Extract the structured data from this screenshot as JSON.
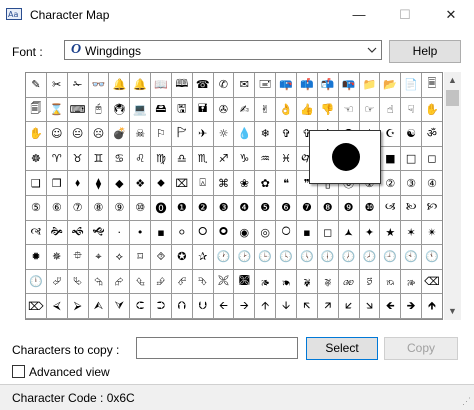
{
  "window": {
    "title": "Character Map",
    "min_glyph": "—",
    "max_glyph": "☐",
    "close_glyph": "✕"
  },
  "font": {
    "label": "Font :",
    "selected": "Wingdings"
  },
  "help_button": "Help",
  "grid": {
    "rows": [
      [
        "✎",
        "✂",
        "✁",
        "👓",
        "🔔",
        "🔔",
        "📖",
        "🕮",
        "☎",
        "✆",
        "✉",
        "🖃",
        "📪",
        "📫",
        "📬",
        "📭",
        "📁",
        "📂",
        "📄",
        "🗏"
      ],
      [
        "🗐",
        "⌛",
        "⌨",
        "🖰",
        "🖲",
        "💻",
        "🖴",
        "🖫",
        "🖬",
        "✇",
        "✍",
        "✌",
        "👌",
        "👍",
        "👎",
        "☜",
        "☞",
        "☝",
        "☟",
        "✋"
      ],
      [
        "✋",
        "☺",
        "😐",
        "☹",
        "💣",
        "☠",
        "⚐",
        "🏱",
        "✈",
        "☼",
        "💧",
        "❄",
        "✞",
        "✞",
        "✝",
        "✠",
        "✡",
        "☪",
        "☯",
        "ॐ"
      ],
      [
        "☸",
        "♈",
        "♉",
        "♊",
        "♋",
        "♌",
        "♍",
        "♎",
        "♏",
        "♐",
        "♑",
        "♒",
        "♓",
        "🙰",
        "🙵",
        "●",
        "🔾",
        "■",
        "□",
        "◻"
      ],
      [
        "❑",
        "❒",
        "⬧",
        "⧫",
        "◆",
        "❖",
        "⬥",
        "⌧",
        "⍓",
        "⌘",
        "❀",
        "✿",
        "❝",
        "❞",
        "▯",
        "⓪",
        "①",
        "②",
        "③",
        "④"
      ],
      [
        "⑤",
        "⑥",
        "⑦",
        "⑧",
        "⑨",
        "⑩",
        "⓿",
        "❶",
        "❷",
        "❸",
        "❹",
        "❺",
        "❻",
        "❼",
        "❽",
        "❾",
        "❿",
        "🙢",
        "🙠",
        "🙡"
      ],
      [
        "🙣",
        "🙞",
        "🙜",
        "🙝",
        "·",
        "•",
        "▪",
        "⚪",
        "🞆",
        "🞈",
        "◉",
        "◎",
        "🞅",
        "▪",
        "◻",
        "🟂",
        "✦",
        "★",
        "✶",
        "✴"
      ],
      [
        "✹",
        "✵",
        "⯐",
        "⌖",
        "⟡",
        "⌑",
        "⯑",
        "✪",
        "✰",
        "🕐",
        "🕑",
        "🕒",
        "🕓",
        "🕔",
        "🕕",
        "🕖",
        "🕗",
        "🕘",
        "🕙",
        "🕚"
      ],
      [
        "🕛",
        "⮰",
        "⮱",
        "⮲",
        "⮳",
        "⮴",
        "⮵",
        "⮶",
        "⮷",
        "🙪",
        "🙫",
        "🙕",
        "🙔",
        "🙗",
        "🙖",
        "🙐",
        "🙑",
        "🙒",
        "🙓",
        "⌫"
      ],
      [
        "⌦",
        "⮘",
        "⮚",
        "⮙",
        "⮛",
        "⮈",
        "⮊",
        "⮉",
        "⮋",
        "🡨",
        "🡪",
        "🡩",
        "🡫",
        "🡬",
        "🡭",
        "🡯",
        "🡮",
        "🡸",
        "🡺",
        "🡹"
      ]
    ]
  },
  "zoom_char": "●",
  "scroll": {
    "up": "▲",
    "down": "▼"
  },
  "copy": {
    "label": "Characters to copy :",
    "value": ""
  },
  "select_button": "Select",
  "copy_button": "Copy",
  "advanced_view": {
    "label": "Advanced view",
    "checked": false
  },
  "status": {
    "text": "Character Code : 0x6C"
  },
  "colors": {
    "select_border": "#0078d7",
    "window_bg": "#ffffff",
    "status_bg": "#f0f0f0"
  }
}
